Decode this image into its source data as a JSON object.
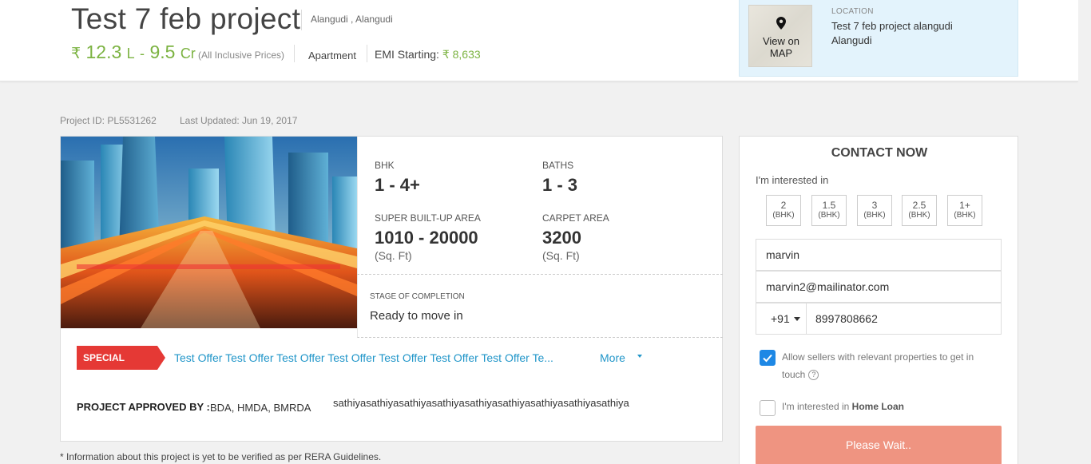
{
  "header": {
    "title": "Test 7 feb project",
    "locality": "Alangudi , Alangudi",
    "price": {
      "rs_symbol": "₹",
      "min": "12.3",
      "min_unit": "L",
      "sep": "-",
      "max": "9.5",
      "max_unit": "Cr"
    },
    "price_note": "(All Inclusive Prices)",
    "property_type": "Apartment",
    "emi_label": "EMI Starting:",
    "emi_value": "₹ 8,633",
    "colors": {
      "price": "#7cb342",
      "link": "#2196c9",
      "offer": "#e53935",
      "button": "#ef9481"
    }
  },
  "location_box": {
    "map_label_line1": "View on",
    "map_label_line2": "MAP",
    "label": "LOCATION",
    "value_line1": "Test 7 feb project alangudi",
    "value_line2": "Alangudi",
    "pin_icon": "map-pin-icon"
  },
  "meta": {
    "project_id": "Project ID: PL5531262",
    "last_updated": "Last Updated: Jun 19, 2017"
  },
  "facts": {
    "bhk_label": "BHK",
    "bhk_value": "1 - 4+",
    "baths_label": "BATHS",
    "baths_value": "1 - 3",
    "sba_label": "SUPER BUILT-UP AREA",
    "sba_value": "1010 - 20000",
    "sba_unit": "(Sq. Ft)",
    "carpet_label": "CARPET AREA",
    "carpet_value": "3200",
    "carpet_unit": "(Sq. Ft)"
  },
  "stage": {
    "label": "STAGE OF COMPLETION",
    "value": "Ready to move in"
  },
  "offer": {
    "badge": "SPECIAL OFFER",
    "text": "Test Offer Test Offer Test Offer Test Offer Test Offer Test Offer Test Offer Te...",
    "more": "More"
  },
  "approved": {
    "label": "PROJECT APPROVED BY :",
    "value": "BDA, HMDA, BMRDA",
    "extra": "sathiyasathiyasathiyasathiyasathiyasathiyasathiyasathiyasathiya"
  },
  "rera_note": "* Information about this project is yet to be verified as per RERA Guidelines.",
  "contact": {
    "title": "CONTACT NOW",
    "interest_label": "I'm interested in",
    "bhk_options": [
      {
        "num": "2",
        "unit": "(BHK)"
      },
      {
        "num": "1.5",
        "unit": "(BHK)"
      },
      {
        "num": "3",
        "unit": "(BHK)"
      },
      {
        "num": "2.5",
        "unit": "(BHK)"
      },
      {
        "num": "1+",
        "unit": "(BHK)"
      }
    ],
    "name_value": "marvin",
    "email_value": "marvin2@mailinator.com",
    "country_code": "+91",
    "phone_value": "8997808662",
    "allow_sellers_line1": "Allow sellers with relevant properties to get in",
    "allow_sellers_line2": "touch",
    "allow_sellers_checked": true,
    "home_loan_prefix": "I'm interested in",
    "home_loan_bold": "Home Loan",
    "home_loan_checked": false,
    "submit_label": "Please Wait.."
  }
}
